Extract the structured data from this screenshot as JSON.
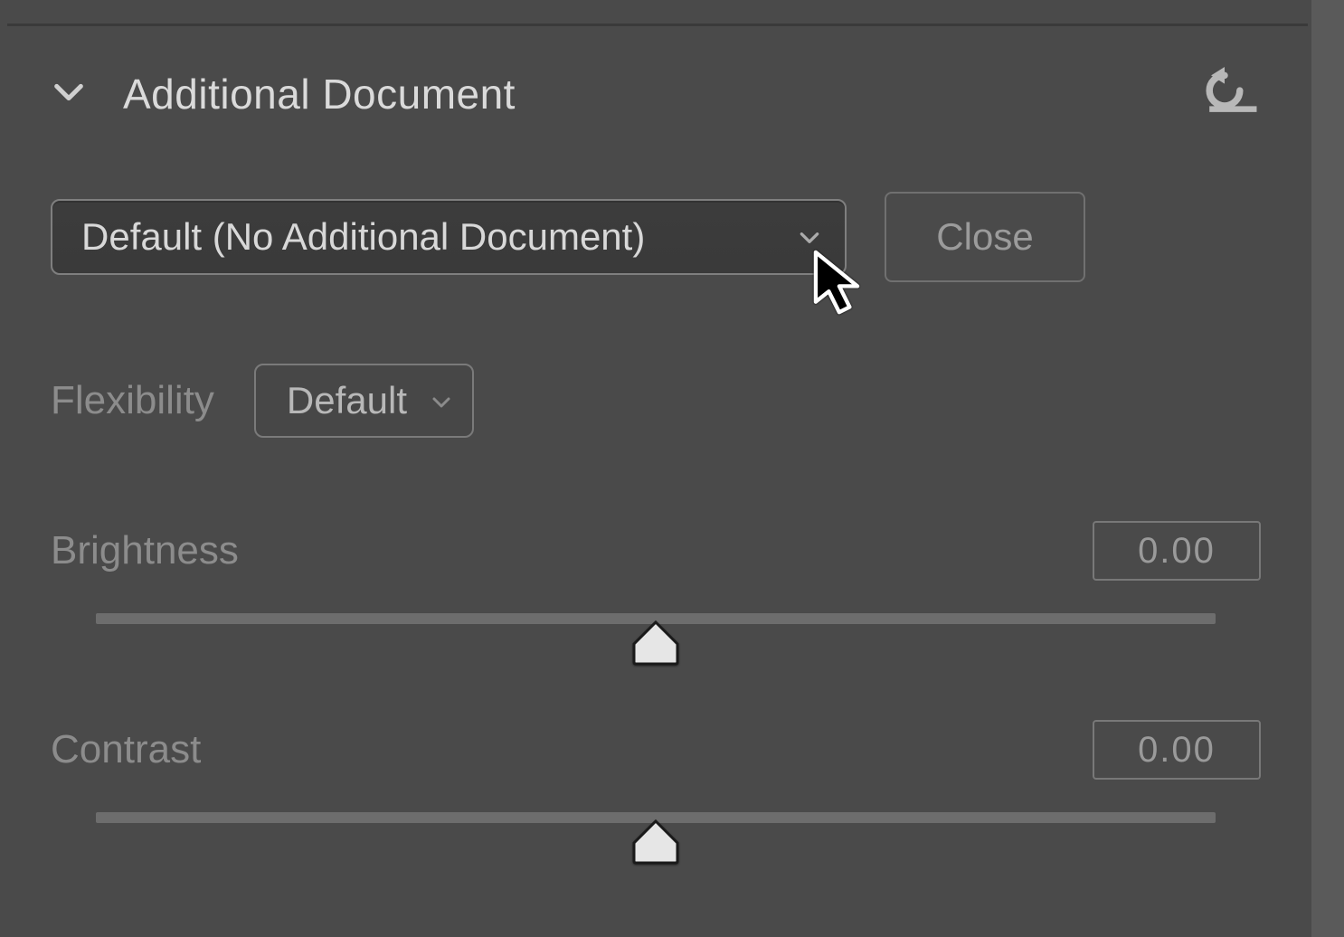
{
  "section": {
    "title": "Additional Document"
  },
  "document_dropdown": {
    "selected": "Default (No Additional Document)"
  },
  "close_button_label": "Close",
  "flexibility": {
    "label": "Flexibility",
    "selected": "Default"
  },
  "sliders": {
    "brightness": {
      "label": "Brightness",
      "value": "0.00",
      "position_percent": 50
    },
    "contrast": {
      "label": "Contrast",
      "value": "0.00",
      "position_percent": 50
    }
  }
}
